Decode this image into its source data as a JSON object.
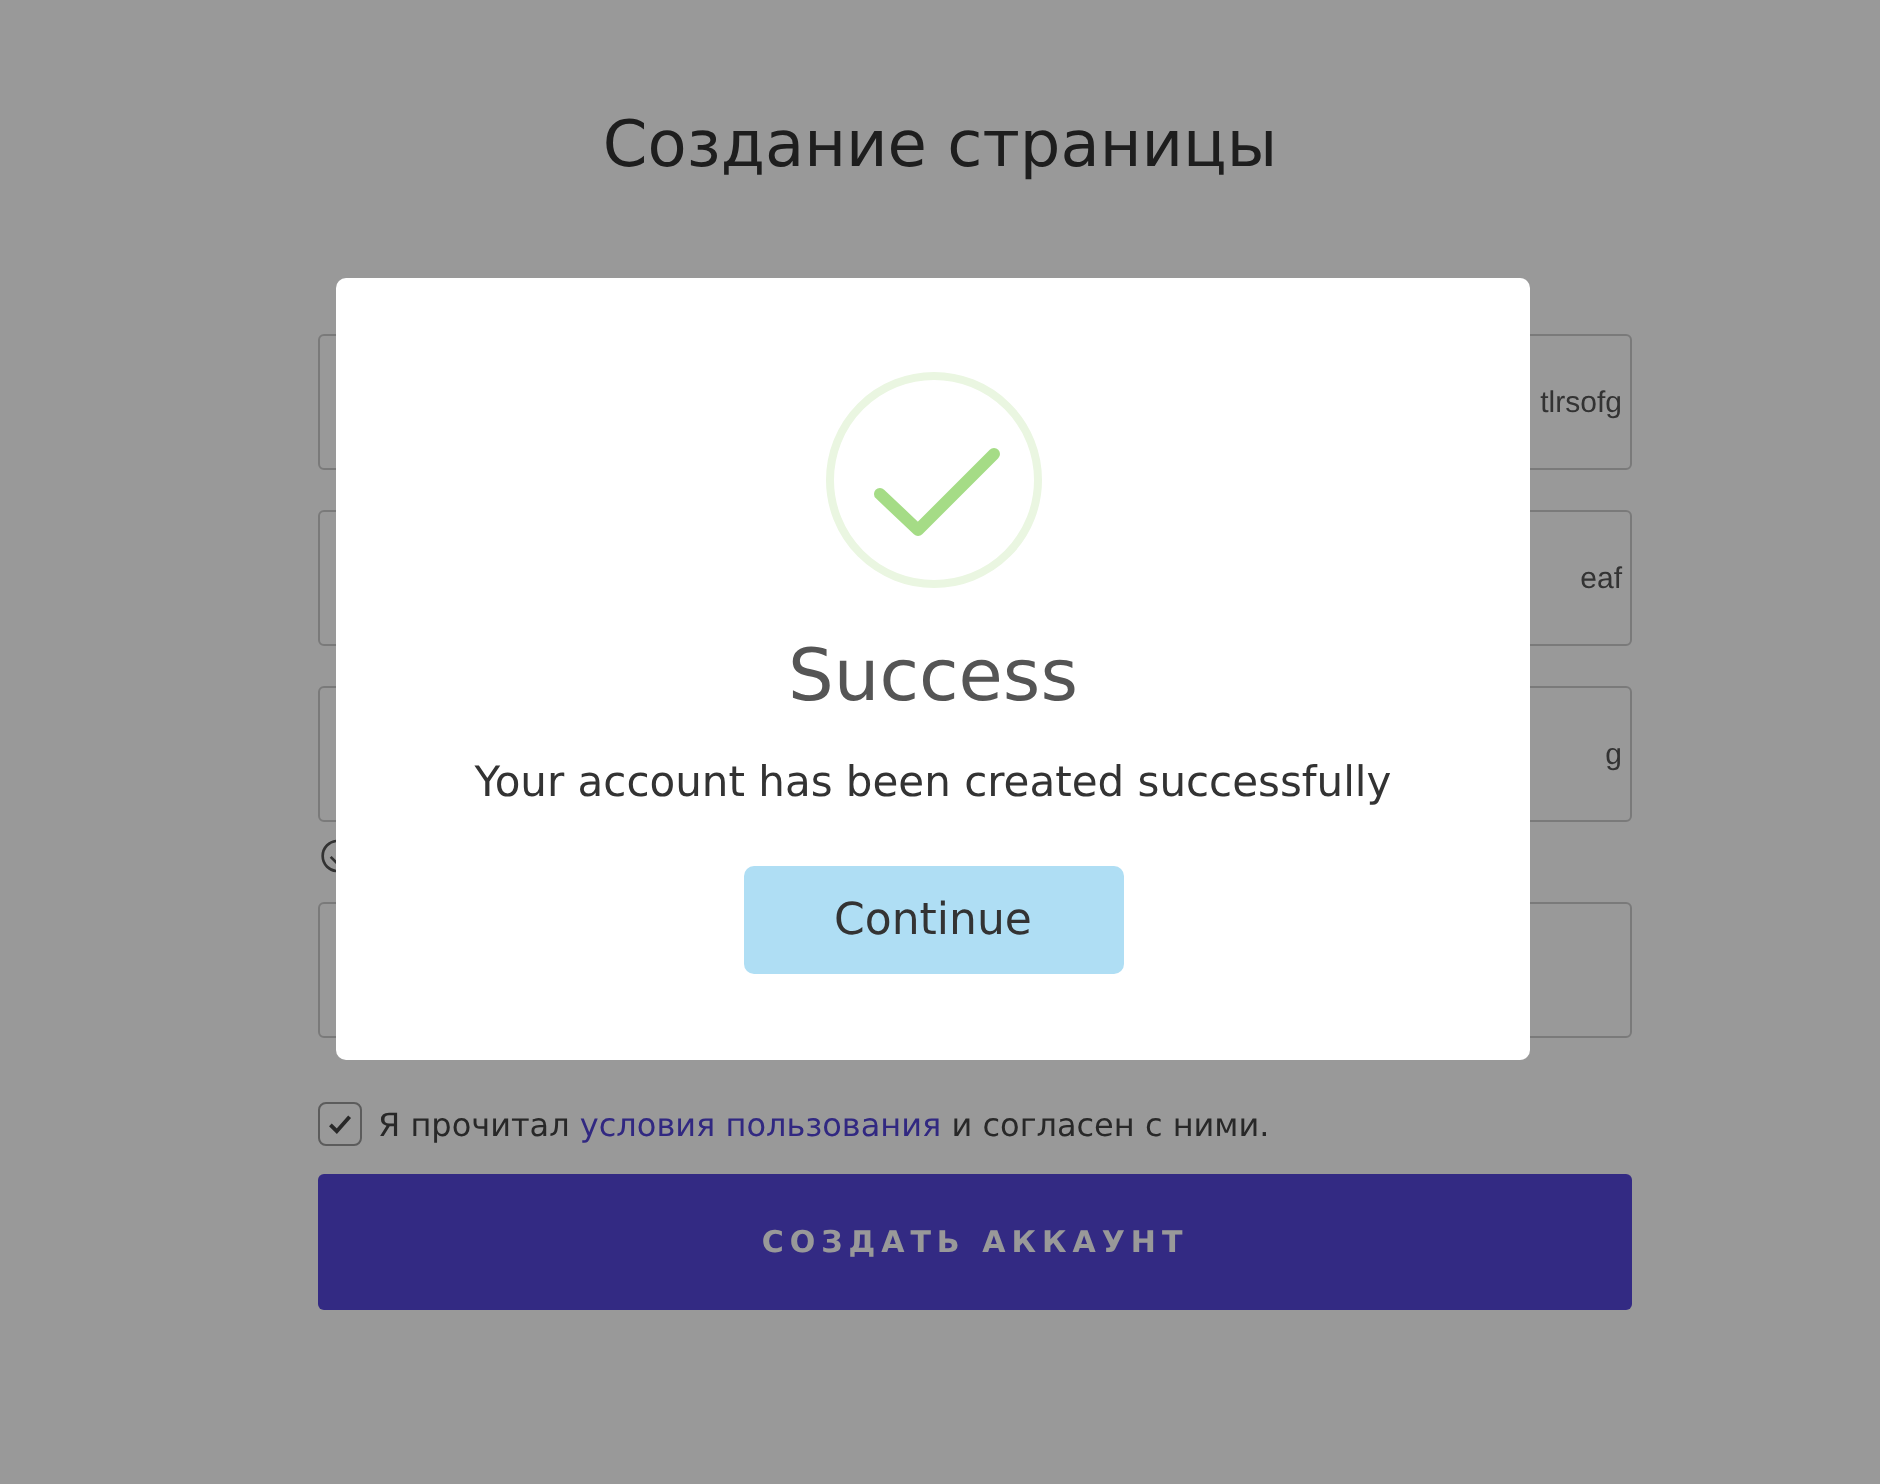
{
  "page": {
    "title": "Создание страницы"
  },
  "form": {
    "fields": [
      {
        "kind": "text",
        "value": "tlrsofg"
      },
      {
        "kind": "text",
        "value": "eaf"
      },
      {
        "kind": "text",
        "value": "g"
      },
      {
        "kind": "text"
      }
    ],
    "terms": {
      "checked": true,
      "before": "Я прочитал",
      "link": "условия пользования",
      "after": "и согласен с ними."
    },
    "submit": "СОЗДАТЬ АККАУНТ"
  },
  "dialog": {
    "title": "Success",
    "message": "Your account has been created successfully",
    "button": "Continue"
  }
}
